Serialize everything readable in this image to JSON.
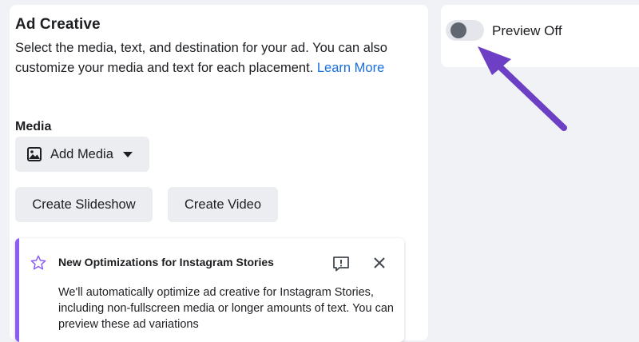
{
  "ad_creative": {
    "title": "Ad Creative",
    "description": "Select the media, text, and destination for your ad. You can also customize your media and text for each placement.",
    "learn_more": "Learn More"
  },
  "media": {
    "label": "Media",
    "add_media": "Add Media",
    "create_slideshow": "Create Slideshow",
    "create_video": "Create Video"
  },
  "notice": {
    "title": "New Optimizations for Instagram Stories",
    "body": "We'll automatically optimize ad creative for Instagram Stories, including non-fullscreen media or longer amounts of text. You can preview these ad variations",
    "icons": [
      "star-icon",
      "feedback-icon",
      "close-icon"
    ]
  },
  "preview": {
    "label": "Preview Off",
    "enabled": false
  },
  "colors": {
    "link": "#1b6fe0",
    "accent": "#8b5cf6",
    "annotation_arrow": "#6c3fc4"
  }
}
